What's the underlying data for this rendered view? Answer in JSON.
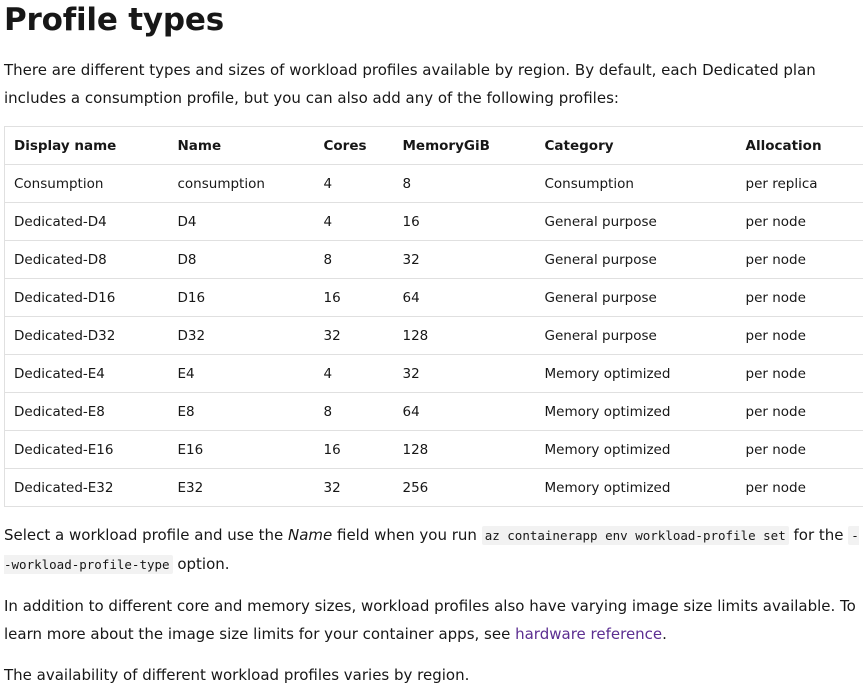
{
  "heading": "Profile types",
  "intro": "There are different types and sizes of workload profiles available by region. By default, each Dedicated plan includes a consumption profile, but you can also add any of the following profiles:",
  "table": {
    "headers": [
      "Display name",
      "Name",
      "Cores",
      "MemoryGiB",
      "Category",
      "Allocation"
    ],
    "rows": [
      [
        "Consumption",
        "consumption",
        "4",
        "8",
        "Consumption",
        "per replica"
      ],
      [
        "Dedicated-D4",
        "D4",
        "4",
        "16",
        "General purpose",
        "per node"
      ],
      [
        "Dedicated-D8",
        "D8",
        "8",
        "32",
        "General purpose",
        "per node"
      ],
      [
        "Dedicated-D16",
        "D16",
        "16",
        "64",
        "General purpose",
        "per node"
      ],
      [
        "Dedicated-D32",
        "D32",
        "32",
        "128",
        "General purpose",
        "per node"
      ],
      [
        "Dedicated-E4",
        "E4",
        "4",
        "32",
        "Memory optimized",
        "per node"
      ],
      [
        "Dedicated-E8",
        "E8",
        "8",
        "64",
        "Memory optimized",
        "per node"
      ],
      [
        "Dedicated-E16",
        "E16",
        "16",
        "128",
        "Memory optimized",
        "per node"
      ],
      [
        "Dedicated-E32",
        "E32",
        "32",
        "256",
        "Memory optimized",
        "per node"
      ]
    ]
  },
  "select_paragraph": {
    "part1": "Select a workload profile and use the ",
    "name_em": "Name",
    "part2": " field when you run ",
    "code1": "az containerapp env workload-profile set",
    "part3": " for the ",
    "code2": "--workload-profile-type",
    "part4": " option."
  },
  "size_paragraph": {
    "part1": "In addition to different core and memory sizes, workload profiles also have varying image size limits available. To learn more about the image size limits for your container apps, see ",
    "link": "hardware reference",
    "part2": "."
  },
  "availability": "The availability of different workload profiles varies by region.",
  "colors": {
    "text": "#171717",
    "link": "#5c2e91",
    "border": "#e0e0e0",
    "code_bg": "#f2f2f2"
  }
}
